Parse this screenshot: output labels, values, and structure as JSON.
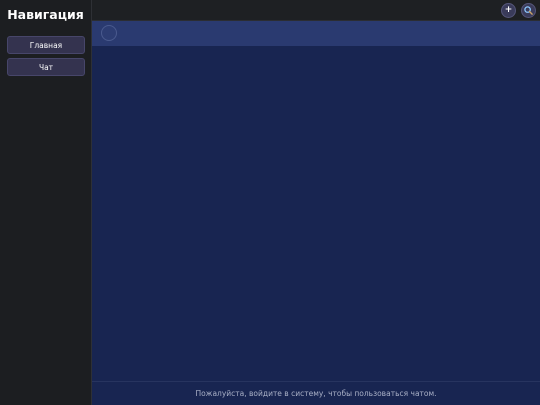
{
  "sidebar": {
    "title": "Навигация",
    "items": [
      {
        "label": "Главная"
      },
      {
        "label": "Чат"
      }
    ]
  },
  "topbar": {
    "add_icon": "plus-icon",
    "search_icon": "search-icon"
  },
  "chat": {
    "login_prompt": "Пожалуйста, войдите в систему, чтобы пользоваться чатом."
  },
  "colors": {
    "sidebar_bg": "#1c1e21",
    "chat_bg": "#182551",
    "chat_header_bg": "#2a3a70",
    "nav_button_bg": "#34334f"
  }
}
